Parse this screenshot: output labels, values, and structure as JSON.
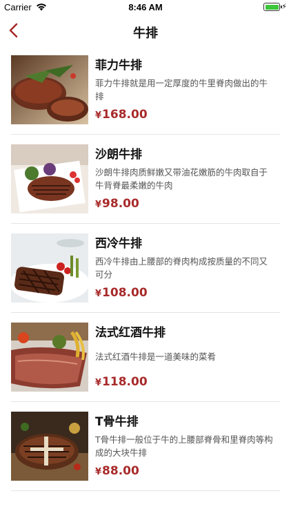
{
  "status_bar": {
    "carrier": "Carrier",
    "time": "8:46 AM",
    "battery_color": "#3dc63b"
  },
  "nav": {
    "title": "牛排",
    "back_icon": "chevron-left-icon",
    "accent_color": "#a82a2a"
  },
  "currency_symbol": "¥",
  "items": [
    {
      "name": "菲力牛排",
      "desc": "菲力牛排就是用一定厚度的牛里脊肉做出的牛排",
      "price": "168.00",
      "image": "steak-photo"
    },
    {
      "name": "沙朗牛排",
      "desc": "沙朗牛排肉质鲜嫩又带油花嫩筋的牛肉取自于牛背脊最柔嫩的牛肉",
      "price": "98.00",
      "image": "steak-photo"
    },
    {
      "name": "西冷牛排",
      "desc": "西冷牛排由上腰部的脊肉构成按质量的不同又可分",
      "price": "108.00",
      "image": "steak-photo"
    },
    {
      "name": "法式红酒牛排",
      "desc": "法式红酒牛排是一道美味的菜肴",
      "price": "118.00",
      "image": "steak-photo"
    },
    {
      "name": "T骨牛排",
      "desc": "T骨牛排一般位于牛的上腰部脊骨和里脊肉等构成的大块牛排",
      "price": "88.00",
      "image": "steak-photo"
    }
  ]
}
